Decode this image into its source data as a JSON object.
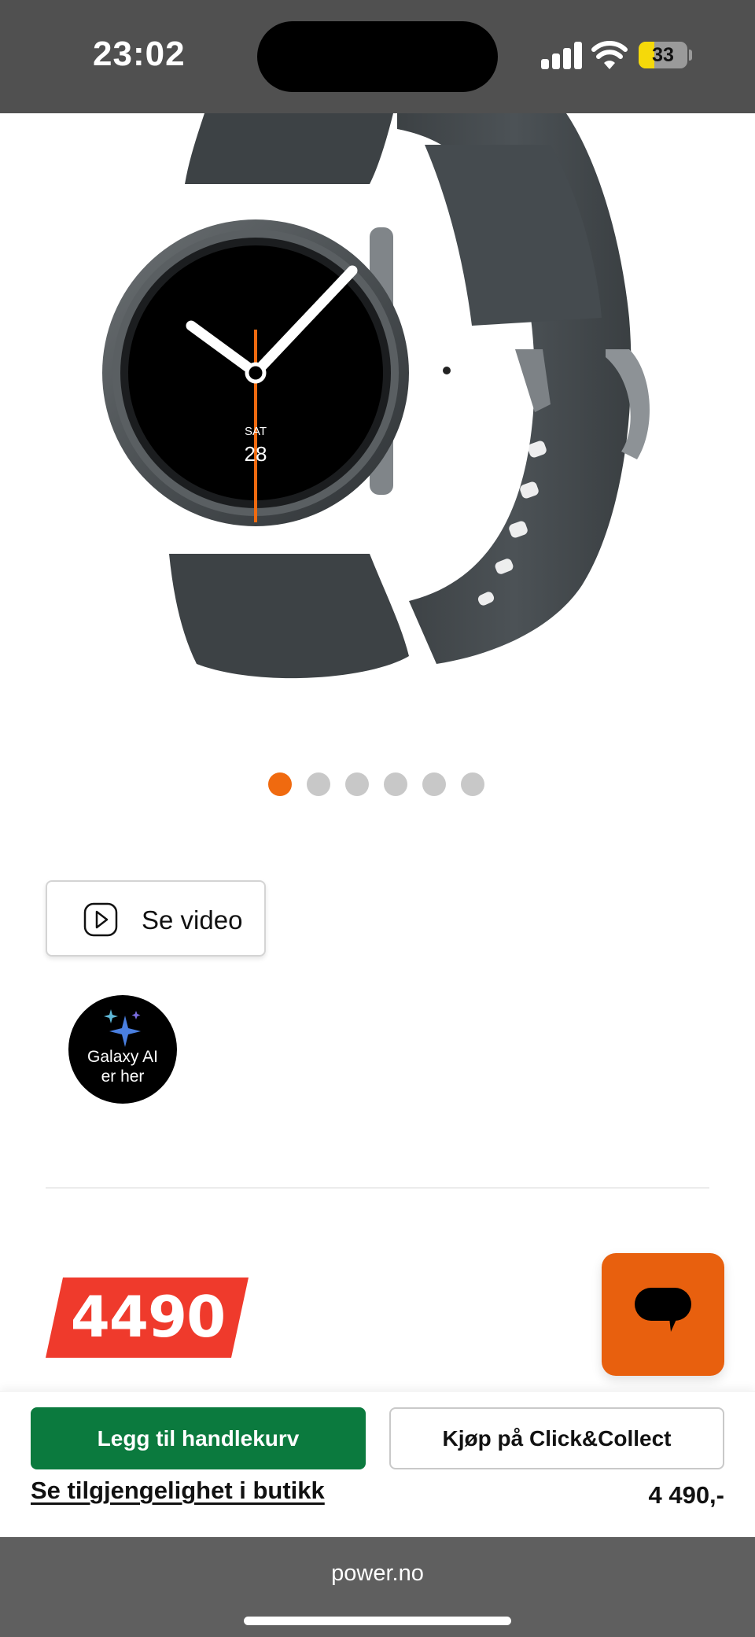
{
  "status_bar": {
    "time": "23:02",
    "battery_level": "33",
    "signal_icon": "cellular-signal-icon",
    "wifi_icon": "wifi-icon",
    "battery_icon": "battery-icon"
  },
  "product": {
    "image_alt": "Samsung Galaxy Watch",
    "watch_face": {
      "day": "SAT",
      "date": "28"
    },
    "carousel": {
      "total": 6,
      "active_index": 0
    }
  },
  "video": {
    "label": "Se video",
    "icon": "play-icon"
  },
  "badge": {
    "line1": "Galaxy AI",
    "line2": "er her",
    "icon": "sparkles-icon"
  },
  "price": {
    "tag": "4490",
    "display": "4 490,-"
  },
  "chat": {
    "icon": "chat-bubble-icon"
  },
  "actions": {
    "add_to_cart": "Legg til handlekurv",
    "click_collect": "Kjøp på Click&Collect",
    "store_availability": "Se tilgjengelighet i butikk"
  },
  "browser": {
    "url": "power.no"
  },
  "colors": {
    "accent_orange": "#f06a0f",
    "cart_green": "#0b7a3e",
    "price_red": "#ef3a2c"
  }
}
